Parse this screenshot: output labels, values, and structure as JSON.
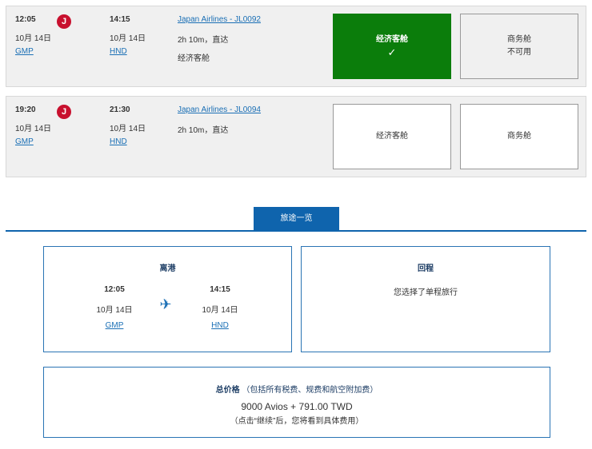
{
  "flights": [
    {
      "dep_time": "12:05",
      "dep_date": "10月 14日",
      "dep_airport": "GMP",
      "arr_time": "14:15",
      "arr_date": "10月 14日",
      "arr_airport": "HND",
      "flight": "Japan Airlines - JL0092",
      "duration": "2h 10m，直达",
      "cabin": "经济客舱",
      "economy": {
        "label": "经济客舱",
        "check": "✓"
      },
      "business": {
        "label": "商务舱",
        "status": "不可用"
      }
    },
    {
      "dep_time": "19:20",
      "dep_date": "10月 14日",
      "dep_airport": "GMP",
      "arr_time": "21:30",
      "arr_date": "10月 14日",
      "arr_airport": "HND",
      "flight": "Japan Airlines - JL0094",
      "duration": "2h 10m，直达",
      "economy": {
        "label": "经济客舱"
      },
      "business": {
        "label": "商务舱"
      }
    }
  ],
  "summary": {
    "tab": "旅途一览",
    "outbound": {
      "title": "离港",
      "dep_time": "12:05",
      "dep_date": "10月 14日",
      "dep_airport": "GMP",
      "arr_time": "14:15",
      "arr_date": "10月 14日",
      "arr_airport": "HND"
    },
    "return": {
      "title": "回程",
      "text": "您选择了单程旅行"
    },
    "price": {
      "title": "总价格",
      "note": "（包括所有税费、规费和航空附加费）",
      "amount": "9000 Avios + 791.00 TWD",
      "hint": "（点击“继续”后，您将看到具体费用）"
    }
  },
  "colors": {
    "selected": "#0b7d0b",
    "brand": "#0f64ad",
    "logo": "#c8102e"
  }
}
